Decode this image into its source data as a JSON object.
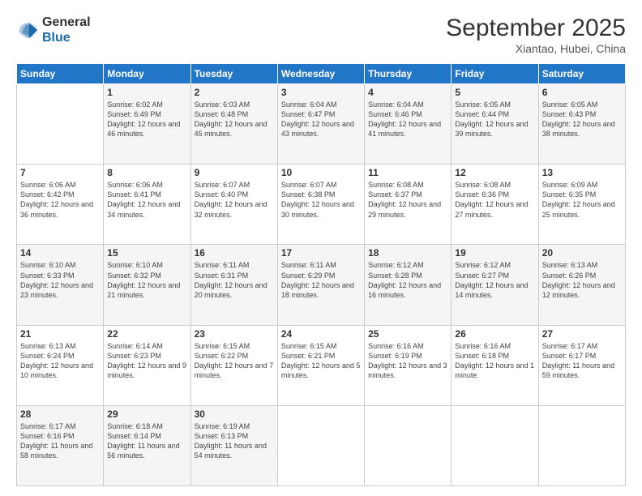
{
  "header": {
    "logo_general": "General",
    "logo_blue": "Blue",
    "month_year": "September 2025",
    "location": "Xiantao, Hubei, China"
  },
  "weekdays": [
    "Sunday",
    "Monday",
    "Tuesday",
    "Wednesday",
    "Thursday",
    "Friday",
    "Saturday"
  ],
  "weeks": [
    [
      {
        "day": "",
        "sunrise": "",
        "sunset": "",
        "daylight": ""
      },
      {
        "day": "1",
        "sunrise": "Sunrise: 6:02 AM",
        "sunset": "Sunset: 6:49 PM",
        "daylight": "Daylight: 12 hours and 46 minutes."
      },
      {
        "day": "2",
        "sunrise": "Sunrise: 6:03 AM",
        "sunset": "Sunset: 6:48 PM",
        "daylight": "Daylight: 12 hours and 45 minutes."
      },
      {
        "day": "3",
        "sunrise": "Sunrise: 6:04 AM",
        "sunset": "Sunset: 6:47 PM",
        "daylight": "Daylight: 12 hours and 43 minutes."
      },
      {
        "day": "4",
        "sunrise": "Sunrise: 6:04 AM",
        "sunset": "Sunset: 6:46 PM",
        "daylight": "Daylight: 12 hours and 41 minutes."
      },
      {
        "day": "5",
        "sunrise": "Sunrise: 6:05 AM",
        "sunset": "Sunset: 6:44 PM",
        "daylight": "Daylight: 12 hours and 39 minutes."
      },
      {
        "day": "6",
        "sunrise": "Sunrise: 6:05 AM",
        "sunset": "Sunset: 6:43 PM",
        "daylight": "Daylight: 12 hours and 38 minutes."
      }
    ],
    [
      {
        "day": "7",
        "sunrise": "Sunrise: 6:06 AM",
        "sunset": "Sunset: 6:42 PM",
        "daylight": "Daylight: 12 hours and 36 minutes."
      },
      {
        "day": "8",
        "sunrise": "Sunrise: 6:06 AM",
        "sunset": "Sunset: 6:41 PM",
        "daylight": "Daylight: 12 hours and 34 minutes."
      },
      {
        "day": "9",
        "sunrise": "Sunrise: 6:07 AM",
        "sunset": "Sunset: 6:40 PM",
        "daylight": "Daylight: 12 hours and 32 minutes."
      },
      {
        "day": "10",
        "sunrise": "Sunrise: 6:07 AM",
        "sunset": "Sunset: 6:38 PM",
        "daylight": "Daylight: 12 hours and 30 minutes."
      },
      {
        "day": "11",
        "sunrise": "Sunrise: 6:08 AM",
        "sunset": "Sunset: 6:37 PM",
        "daylight": "Daylight: 12 hours and 29 minutes."
      },
      {
        "day": "12",
        "sunrise": "Sunrise: 6:08 AM",
        "sunset": "Sunset: 6:36 PM",
        "daylight": "Daylight: 12 hours and 27 minutes."
      },
      {
        "day": "13",
        "sunrise": "Sunrise: 6:09 AM",
        "sunset": "Sunset: 6:35 PM",
        "daylight": "Daylight: 12 hours and 25 minutes."
      }
    ],
    [
      {
        "day": "14",
        "sunrise": "Sunrise: 6:10 AM",
        "sunset": "Sunset: 6:33 PM",
        "daylight": "Daylight: 12 hours and 23 minutes."
      },
      {
        "day": "15",
        "sunrise": "Sunrise: 6:10 AM",
        "sunset": "Sunset: 6:32 PM",
        "daylight": "Daylight: 12 hours and 21 minutes."
      },
      {
        "day": "16",
        "sunrise": "Sunrise: 6:11 AM",
        "sunset": "Sunset: 6:31 PM",
        "daylight": "Daylight: 12 hours and 20 minutes."
      },
      {
        "day": "17",
        "sunrise": "Sunrise: 6:11 AM",
        "sunset": "Sunset: 6:29 PM",
        "daylight": "Daylight: 12 hours and 18 minutes."
      },
      {
        "day": "18",
        "sunrise": "Sunrise: 6:12 AM",
        "sunset": "Sunset: 6:28 PM",
        "daylight": "Daylight: 12 hours and 16 minutes."
      },
      {
        "day": "19",
        "sunrise": "Sunrise: 6:12 AM",
        "sunset": "Sunset: 6:27 PM",
        "daylight": "Daylight: 12 hours and 14 minutes."
      },
      {
        "day": "20",
        "sunrise": "Sunrise: 6:13 AM",
        "sunset": "Sunset: 6:26 PM",
        "daylight": "Daylight: 12 hours and 12 minutes."
      }
    ],
    [
      {
        "day": "21",
        "sunrise": "Sunrise: 6:13 AM",
        "sunset": "Sunset: 6:24 PM",
        "daylight": "Daylight: 12 hours and 10 minutes."
      },
      {
        "day": "22",
        "sunrise": "Sunrise: 6:14 AM",
        "sunset": "Sunset: 6:23 PM",
        "daylight": "Daylight: 12 hours and 9 minutes."
      },
      {
        "day": "23",
        "sunrise": "Sunrise: 6:15 AM",
        "sunset": "Sunset: 6:22 PM",
        "daylight": "Daylight: 12 hours and 7 minutes."
      },
      {
        "day": "24",
        "sunrise": "Sunrise: 6:15 AM",
        "sunset": "Sunset: 6:21 PM",
        "daylight": "Daylight: 12 hours and 5 minutes."
      },
      {
        "day": "25",
        "sunrise": "Sunrise: 6:16 AM",
        "sunset": "Sunset: 6:19 PM",
        "daylight": "Daylight: 12 hours and 3 minutes."
      },
      {
        "day": "26",
        "sunrise": "Sunrise: 6:16 AM",
        "sunset": "Sunset: 6:18 PM",
        "daylight": "Daylight: 12 hours and 1 minute."
      },
      {
        "day": "27",
        "sunrise": "Sunrise: 6:17 AM",
        "sunset": "Sunset: 6:17 PM",
        "daylight": "Daylight: 11 hours and 59 minutes."
      }
    ],
    [
      {
        "day": "28",
        "sunrise": "Sunrise: 6:17 AM",
        "sunset": "Sunset: 6:16 PM",
        "daylight": "Daylight: 11 hours and 58 minutes."
      },
      {
        "day": "29",
        "sunrise": "Sunrise: 6:18 AM",
        "sunset": "Sunset: 6:14 PM",
        "daylight": "Daylight: 11 hours and 56 minutes."
      },
      {
        "day": "30",
        "sunrise": "Sunrise: 6:19 AM",
        "sunset": "Sunset: 6:13 PM",
        "daylight": "Daylight: 11 hours and 54 minutes."
      },
      {
        "day": "",
        "sunrise": "",
        "sunset": "",
        "daylight": ""
      },
      {
        "day": "",
        "sunrise": "",
        "sunset": "",
        "daylight": ""
      },
      {
        "day": "",
        "sunrise": "",
        "sunset": "",
        "daylight": ""
      },
      {
        "day": "",
        "sunrise": "",
        "sunset": "",
        "daylight": ""
      }
    ]
  ]
}
